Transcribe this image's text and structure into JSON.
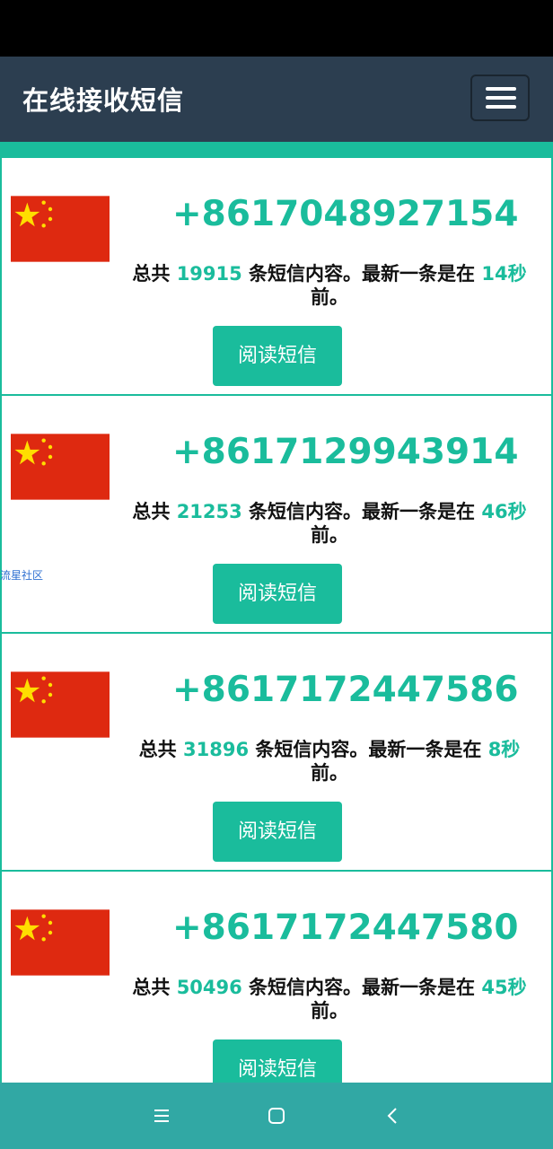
{
  "navbar": {
    "brand": "在线接收短信"
  },
  "cards": [
    {
      "phone": "+8617048927154",
      "prefix": "总共 ",
      "count": "19915",
      "middle": " 条短信内容。最新一条是在 ",
      "time": "14秒",
      "end": "前。",
      "button": "阅读短信"
    },
    {
      "phone": "+8617129943914",
      "prefix": "总共 ",
      "count": "21253",
      "middle": " 条短信内容。最新一条是在 ",
      "time": "46秒",
      "end": "前。",
      "button": "阅读短信"
    },
    {
      "phone": "+8617172447586",
      "prefix": "总共 ",
      "count": "31896",
      "middle": " 条短信内容。最新一条是在 ",
      "time": "8秒",
      "end": "前。",
      "button": "阅读短信"
    },
    {
      "phone": "+8617172447580",
      "prefix": "总共 ",
      "count": "50496",
      "middle": " 条短信内容。最新一条是在 ",
      "time": "45秒",
      "end": "前。",
      "button": "阅读短信"
    }
  ],
  "watermark": "流星社区",
  "system_nav": {
    "menu_icon": "menu-icon",
    "home_icon": "home-icon",
    "back_icon": "back-icon"
  },
  "colors": {
    "accent": "#1abc9c",
    "navbar": "#2c3e50",
    "flag_red": "#de2910",
    "flag_yellow": "#ffde00"
  }
}
